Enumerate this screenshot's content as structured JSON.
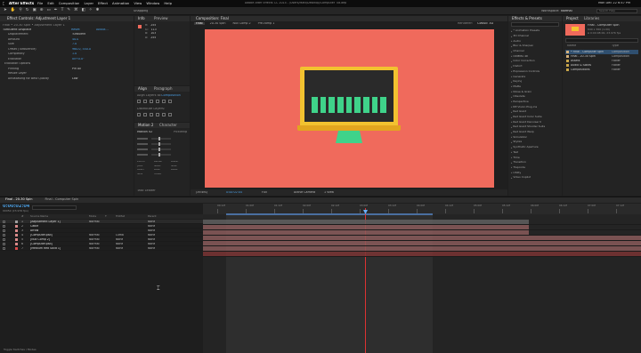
{
  "menu": {
    "app_name": "After Effects",
    "items": [
      "File",
      "Edit",
      "Composition",
      "Layer",
      "Effect",
      "Animation",
      "View",
      "Window",
      "Help"
    ],
    "window_title": "Adobe After Effects CC 2014 - /Users/Matt/Desktop/Computer Tut.aep",
    "clock": "Mon Dec 22 6:47 PM"
  },
  "toolbar": {
    "snapping": "Snapping",
    "workspace_label": "Workspace:",
    "workspace_value": "Normal",
    "search_placeholder": "Search Help"
  },
  "effect_controls": {
    "tab": "Effect Controls: Adjustment Layer 1",
    "path": "Final • 20-30 Spin • Adjustment Layer 1",
    "effect_name": "Turbulent Displace",
    "reset": "Reset",
    "about": "About...",
    "params": [
      {
        "name": "Displacement",
        "value": "Turbulent"
      },
      {
        "name": "Amount",
        "value": "40.0"
      },
      {
        "name": "Size",
        "value": "7.0"
      },
      {
        "name": "Offset (Turbulence)",
        "value": "960.0, 540.0"
      },
      {
        "name": "Complexity",
        "value": "1.0"
      },
      {
        "name": "Evolution",
        "value": "0x+0.0°"
      },
      {
        "name": "Evolution Options",
        "value": ""
      },
      {
        "name": "Pinning",
        "value": "Pin All"
      },
      {
        "name": "Resize Layer",
        "value": ""
      },
      {
        "name": "Antialiasing for Best Quality",
        "value": "Low"
      }
    ]
  },
  "info": {
    "tabs": [
      "Info",
      "Preview"
    ],
    "rgb": [
      "R:",
      "G:",
      "B:",
      "A:"
    ],
    "vals": [
      "255",
      "113",
      "103",
      "255"
    ]
  },
  "align": {
    "tabs": [
      "Align",
      "Paragraph"
    ],
    "align_to_label": "Align Layers to:",
    "align_to_value": "Composition",
    "distribute": "Distribute Layers:"
  },
  "motion": {
    "tabs": [
      "Motion 2",
      "Character"
    ],
    "version": "Motion v2",
    "pickwhip": "Pickwhip",
    "buttons": [
      "EXCITE",
      "BLEND",
      "BURST",
      "JUMP",
      "NAME",
      "NULL",
      "ORBIT",
      "ROPE",
      "WARP",
      "SPIN",
      "STARE"
    ],
    "task": "Task Leader"
  },
  "composition": {
    "tab": "Composition: Final",
    "sub_tabs": [
      "Final",
      "20-30 Spin",
      "Null Comp 2",
      "Pre-comp 1"
    ],
    "renderer_label": "Renderer:",
    "renderer_value": "Classic 3D",
    "zoom": "(39.6%)",
    "timecode": "0:00:02:04",
    "resolution": "Full",
    "camera": "Active Camera",
    "view": "1 View",
    "bars": 9,
    "bg_color": "#f06a5c"
  },
  "effects_presets": {
    "tab": "Effects & Presets",
    "search_placeholder": "",
    "items": [
      "* Animation Presets",
      "3D Channel",
      "Audio",
      "Blur & Sharpen",
      "Channel",
      "CINEMA 4D",
      "Color Correction",
      "Distort",
      "Expression Controls",
      "Generate",
      "Keying",
      "Matte",
      "Noise & Grain",
      "Obsolete",
      "Perspective",
      "RE:Vision Plug-ins",
      "Red Giant",
      "Red Giant Color Suite",
      "Red Giant Denoiser II",
      "Red Giant Shooter Suite",
      "Red Giant Warp",
      "Simulation",
      "Stylize",
      "Synthetic Aperture",
      "Text",
      "Time",
      "Transition",
      "Trapcode",
      "Utility",
      "Video Copilot"
    ]
  },
  "project": {
    "tabs": [
      "Project",
      "Libraries"
    ],
    "thumb_title": "Final - Computer Spin",
    "thumb_info": "640 x 360 (1.00)",
    "thumb_dur": "Δ 0:00:08:00, 23.976 fps",
    "columns": [
      "Name",
      "Type"
    ],
    "items": [
      {
        "name": "* Final - Computer Spin",
        "type": "Composition",
        "color": "#d7b27a"
      },
      {
        "name": "Final - 20-30 Spin",
        "type": "Composition",
        "color": "#d7b27a"
      },
      {
        "name": "Assets",
        "type": "Folder",
        "color": "#c9a64a"
      },
      {
        "name": "Audio & Solids",
        "type": "Folder",
        "color": "#c9a64a"
      },
      {
        "name": "Compositions",
        "type": "Folder",
        "color": "#c9a64a"
      }
    ]
  },
  "timeline": {
    "tabs": [
      "Final - 20-30 Spin",
      "Final - Computer Spin"
    ],
    "timecode": "0:00:02:04",
    "timecode_sub": "00052 (23.976 fps)",
    "search_placeholder": "",
    "columns": [
      "#",
      "Source Name",
      "Mode",
      "T",
      "TrkMat",
      "Parent"
    ],
    "layers": [
      {
        "num": "1",
        "name": "[Adjustment Layer 1]",
        "mode": "Normal",
        "trkmat": "",
        "parent": "None",
        "color": "#9e9e9e"
      },
      {
        "num": "2",
        "name": "Cable",
        "mode": "",
        "trkmat": "",
        "parent": "None",
        "color": "#d98a8a"
      },
      {
        "num": "3",
        "name": "Arrow",
        "mode": "",
        "trkmat": "",
        "parent": "None",
        "color": "#d98a8a"
      },
      {
        "num": "4",
        "name": "[Computer.psd]",
        "mode": "Normal",
        "trkmat": "Luma",
        "parent": "None",
        "color": "#d98a8a"
      },
      {
        "num": "5",
        "name": "[Null Comp 2]",
        "mode": "Normal",
        "trkmat": "None",
        "parent": "None",
        "color": "#d98a8a"
      },
      {
        "num": "6",
        "name": "[Computer.psd]",
        "mode": "Normal",
        "trkmat": "None",
        "parent": "None",
        "color": "#d98a8a"
      },
      {
        "num": "7",
        "name": "[Medium Red Solid 1]",
        "mode": "Normal",
        "trkmat": "None",
        "parent": "None",
        "color": "#d94a4a"
      }
    ],
    "ruler": [
      "00:12f",
      "01:00f",
      "01:12f",
      "02:00f",
      "02:12f",
      "03:00f",
      "03:12f",
      "04:00f",
      "04:12f",
      "05:00f",
      "05:12f",
      "06:00f",
      "06:12f",
      "07:00f",
      "07:12f"
    ],
    "toggle": "Toggle Switches / Modes"
  }
}
